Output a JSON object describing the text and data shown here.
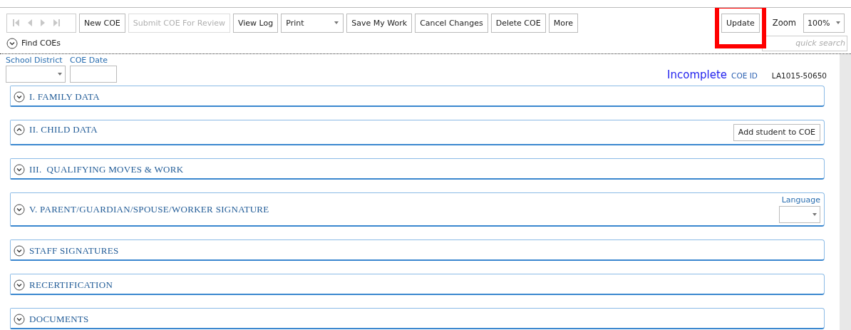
{
  "toolbar": {
    "record_nav": {
      "disabled": true
    },
    "buttons": [
      {
        "kind": "button",
        "label": "New COE",
        "disabled": false
      },
      {
        "kind": "button",
        "label": "Submit COE For Review",
        "disabled": true
      },
      {
        "kind": "button",
        "label": "View Log",
        "disabled": false
      },
      {
        "kind": "select",
        "label": "Print",
        "disabled": false
      },
      {
        "kind": "button",
        "label": "Save My Work",
        "disabled": false
      },
      {
        "kind": "button",
        "label": "Cancel Changes",
        "disabled": false
      },
      {
        "kind": "button",
        "label": "Delete COE",
        "disabled": false
      },
      {
        "kind": "button",
        "label": "More",
        "disabled": false
      }
    ],
    "update_button": {
      "label": "Update",
      "highlighted": true
    },
    "zoom": {
      "label": "Zoom",
      "value": "100%"
    },
    "quick_search": {
      "placeholder": "quick search"
    }
  },
  "find_coes": {
    "label": "Find COEs",
    "expanded": false
  },
  "filters": [
    {
      "kind": "select",
      "label": "School District"
    },
    {
      "kind": "input",
      "label": "COE Date"
    }
  ],
  "status": {
    "state": "Incomplete",
    "id_label": "COE ID",
    "id": "LA1015-50650"
  },
  "sections": [
    {
      "title": "I. FAMILY DATA",
      "expanded": false
    },
    {
      "title": "II. CHILD DATA",
      "expanded": true,
      "action": "Add student to COE"
    },
    {
      "title": "III.  QUALIFYING MOVES & WORK",
      "expanded": false
    },
    {
      "title": "V. PARENT/GUARDIAN/SPOUSE/WORKER SIGNATURE",
      "expanded": false,
      "language_label": "Language"
    },
    {
      "title": "STAFF SIGNATURES",
      "expanded": false
    },
    {
      "title": "RECERTIFICATION",
      "expanded": false
    },
    {
      "title": "DOCUMENTS",
      "expanded": false
    }
  ]
}
